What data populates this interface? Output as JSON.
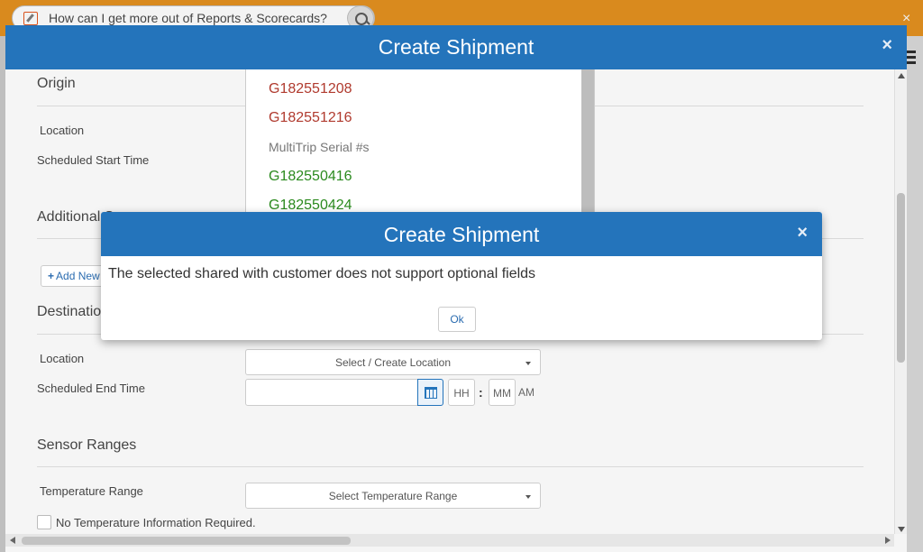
{
  "background": {
    "search_text": "How can I get more out of Reports & Scorecards?",
    "close_glyph": "×"
  },
  "modal": {
    "title": "Create Shipment",
    "close_glyph": "×",
    "origin": {
      "title": "Origin",
      "location_label": "Location",
      "start_time_label": "Scheduled Start Time"
    },
    "additional": {
      "title": "Additional S",
      "add_new_label": "Add New"
    },
    "destination": {
      "title": "Destination",
      "location_label": "Location",
      "location_placeholder": "Select / Create Location",
      "end_time_label": "Scheduled End Time",
      "hh": "HH",
      "mm": "MM",
      "colon": ":",
      "ampm": "AM"
    },
    "sensor": {
      "title": "Sensor Ranges",
      "temp_label": "Temperature Range",
      "temp_placeholder": "Select Temperature Range",
      "no_temp_label": "No Temperature Information Required."
    },
    "serial_dropdown": {
      "items": [
        {
          "text": "G182551208",
          "color": "#b03a2e"
        },
        {
          "text": "G182551216",
          "color": "#b03a2e"
        },
        {
          "text": "MultiTrip Serial #s",
          "header": true
        },
        {
          "text": "G182550416",
          "color": "#2b8a1e"
        },
        {
          "text": "G182550424",
          "color": "#2b8a1e"
        }
      ]
    }
  },
  "alert": {
    "title": "Create Shipment",
    "close_glyph": "×",
    "message": "The selected shared with customer does not support optional fields",
    "ok_label": "Ok"
  },
  "colors": {
    "header_blue": "#2474bb",
    "topbar_orange": "#d98a1e"
  }
}
